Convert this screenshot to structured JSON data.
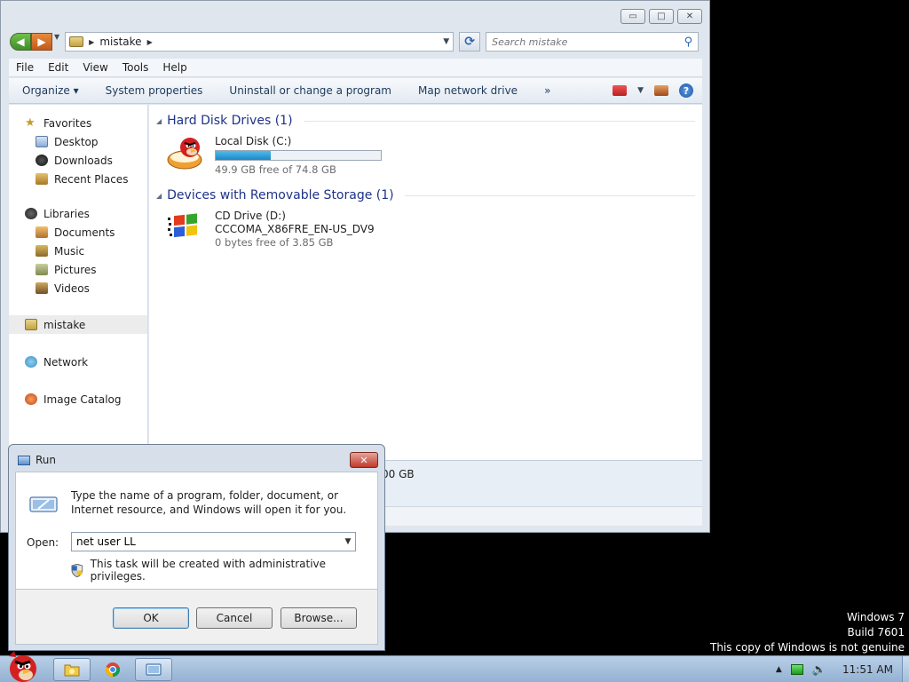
{
  "explorer": {
    "title_buttons": {
      "minimize": "▭",
      "maximize": "□",
      "close": "✕"
    },
    "address": {
      "location": "mistake"
    },
    "search": {
      "placeholder": "Search mistake"
    },
    "menu": [
      "File",
      "Edit",
      "View",
      "Tools",
      "Help"
    ],
    "commands": [
      "Organize ▾",
      "System properties",
      "Uninstall or change a program",
      "Map network drive",
      "»"
    ],
    "nav": {
      "favorites": "Favorites",
      "favorites_items": [
        "Desktop",
        "Downloads",
        "Recent Places"
      ],
      "libraries": "Libraries",
      "libraries_items": [
        "Documents",
        "Music",
        "Pictures",
        "Videos"
      ],
      "homegroup": "mistake",
      "network": "Network",
      "image_catalog": "Image Catalog"
    },
    "groups": {
      "hard_disk": {
        "title": "Hard Disk Drives (1)",
        "drive_name": "Local Disk (C:)",
        "free_text": "49.9 GB free of 74.8 GB",
        "used_fraction": 0.333
      },
      "removable": {
        "title": "Devices with Removable Storage (1)",
        "drive_name": "CD Drive (D:)",
        "label": "CCCOMA_X86FRE_EN-US_DV9",
        "free_text": "0 bytes free of 3.85 GB"
      }
    },
    "details_text": "00 GB"
  },
  "run_dialog": {
    "title": "Run",
    "close": "✕",
    "description": "Type the name of a program, folder, document, or Internet resource, and Windows will open it for you.",
    "open_label": "Open:",
    "open_value": "net user LL",
    "admin_note": "This task will be created with administrative privileges.",
    "buttons": {
      "ok": "OK",
      "cancel": "Cancel",
      "browse": "Browse..."
    }
  },
  "watermark": {
    "line1": "Windows 7",
    "line2": "Build 7601",
    "line3": "This copy of Windows is not genuine"
  },
  "taskbar": {
    "clock": "11:51 AM",
    "tray_arrow": "▲"
  },
  "colors": {
    "group_title": "#1e3287",
    "usage_fill": "#1e86c8",
    "taskbar": "#93b2d3"
  }
}
